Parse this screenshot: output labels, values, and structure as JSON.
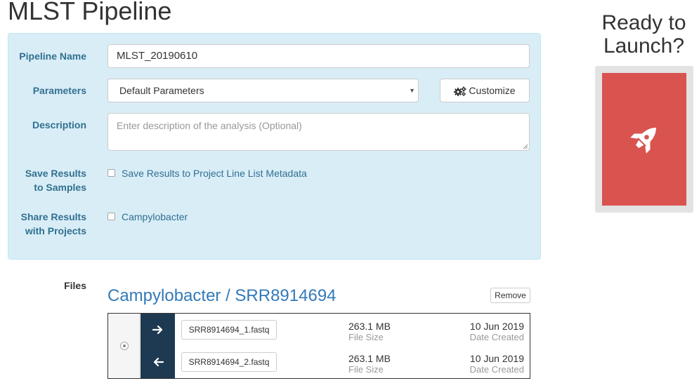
{
  "page": {
    "title": "MLST Pipeline"
  },
  "form": {
    "pipeline_name": {
      "label": "Pipeline Name",
      "value": "MLST_20190610"
    },
    "parameters": {
      "label": "Parameters",
      "selected": "Default Parameters",
      "customize_label": "Customize"
    },
    "description": {
      "label": "Description",
      "placeholder": "Enter description of the analysis (Optional)"
    },
    "save_results": {
      "label_line1": "Save Results",
      "label_line2": "to Samples",
      "checkbox_label": "Save Results to Project Line List Metadata",
      "checked": false
    },
    "share_results": {
      "label_line1": "Share Results",
      "label_line2": "with Projects",
      "checkbox_label": "Campylobacter",
      "checked": false
    }
  },
  "launch": {
    "title_line1": "Ready to",
    "title_line2": "Launch?",
    "button_icon": "rocket-icon",
    "button_color": "#d9534f"
  },
  "files": {
    "label": "Files",
    "sample_title": "Campylobacter / SRR8914694",
    "remove_label": "Remove",
    "rows": [
      {
        "direction_icon": "arrow-right-icon",
        "name": "SRR8914694_1.fastq",
        "size": "263.1 MB",
        "size_label": "File Size",
        "date": "10 Jun 2019",
        "date_label": "Date Created"
      },
      {
        "direction_icon": "arrow-left-icon",
        "name": "SRR8914694_2.fastq",
        "size": "263.1 MB",
        "size_label": "File Size",
        "date": "10 Jun 2019",
        "date_label": "Date Created"
      }
    ]
  },
  "colors": {
    "accent": "#337ab7",
    "panel_bg": "#d9edf7",
    "panel_text": "#31708f",
    "arrow_cell": "#1e3a52"
  }
}
